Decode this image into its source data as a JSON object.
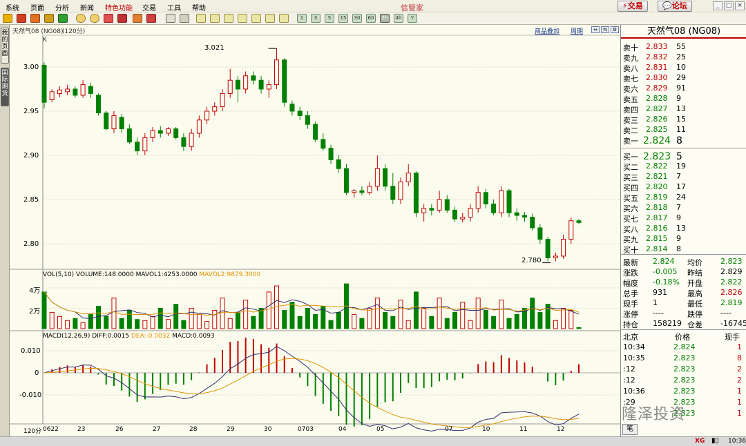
{
  "menu": [
    "系统",
    "页面",
    "分析",
    "新闻",
    "特色功能",
    "交易",
    "工具",
    "帮助"
  ],
  "app_title": "信管家",
  "header_buttons": {
    "trade": "交易",
    "forum": "论坛"
  },
  "toolbar_period_labels": [
    "1",
    "3",
    "5",
    "15",
    "30",
    "60",
    "2h",
    "4h",
    "Y"
  ],
  "left_tabs": [
    "我的页面",
    "国际期货"
  ],
  "chart_header": {
    "title": "天然气08 (NG08)",
    "period": "(120分)",
    "overlay_link": "商品叠加",
    "cycle_link": "周期",
    "type_label": "K",
    "period_label": "120分"
  },
  "kline": {
    "y_ticks": [
      "3.00",
      "2.95",
      "2.90",
      "2.85",
      "2.80"
    ],
    "high_mark": "3.021",
    "low_mark": "2.780"
  },
  "volume_panel": {
    "legend_prefix": "VOL(5,10)",
    "volume": "VOLUME:148.0000",
    "mavol1": "MAVOL1:4253.0000",
    "mavol2": "MAVOL2:9879.3000",
    "y_ticks": [
      "4万",
      "2万"
    ]
  },
  "macd_panel": {
    "legend_prefix": "MACD(12,26,9)",
    "diff": "DIFF:0.0015",
    "dea": "DEA:-0.0032",
    "macd": "MACD:0.0093",
    "y_ticks": [
      "0.010",
      "0",
      "-0.010"
    ]
  },
  "x_axis": [
    "0622",
    "23",
    "26",
    "27",
    "28",
    "29",
    "30",
    "0703",
    "04",
    "05",
    "07",
    "10",
    "11",
    "12"
  ],
  "quote": {
    "title": "天然气08 (NG08)",
    "asks": [
      {
        "label": "卖十",
        "price": "2.833",
        "vol": "55"
      },
      {
        "label": "卖九",
        "price": "2.832",
        "vol": "25"
      },
      {
        "label": "卖八",
        "price": "2.831",
        "vol": "10"
      },
      {
        "label": "卖七",
        "price": "2.830",
        "vol": "29"
      },
      {
        "label": "卖六",
        "price": "2.829",
        "vol": "91"
      },
      {
        "label": "卖五",
        "price": "2.828",
        "vol": "9"
      },
      {
        "label": "卖四",
        "price": "2.827",
        "vol": "13"
      },
      {
        "label": "卖三",
        "price": "2.826",
        "vol": "15"
      },
      {
        "label": "卖二",
        "price": "2.825",
        "vol": "11"
      },
      {
        "label": "卖一",
        "price": "2.824",
        "vol": "8"
      }
    ],
    "bids": [
      {
        "label": "买一",
        "price": "2.823",
        "vol": "5"
      },
      {
        "label": "买二",
        "price": "2.822",
        "vol": "19"
      },
      {
        "label": "买三",
        "price": "2.821",
        "vol": "7"
      },
      {
        "label": "买四",
        "price": "2.820",
        "vol": "17"
      },
      {
        "label": "买五",
        "price": "2.819",
        "vol": "24"
      },
      {
        "label": "买六",
        "price": "2.818",
        "vol": "7"
      },
      {
        "label": "买七",
        "price": "2.817",
        "vol": "9"
      },
      {
        "label": "买八",
        "price": "2.816",
        "vol": "13"
      },
      {
        "label": "买九",
        "price": "2.815",
        "vol": "9"
      },
      {
        "label": "买十",
        "price": "2.814",
        "vol": "8"
      }
    ],
    "stats": [
      {
        "l1": "最新",
        "v1": "2.824",
        "l2": "均价",
        "v2": "2.823"
      },
      {
        "l1": "涨跌",
        "v1": "-0.005",
        "l2": "昨结",
        "v2": "2.829"
      },
      {
        "l1": "幅度",
        "v1": "-0.18%",
        "l2": "开盘",
        "v2": "2.822"
      },
      {
        "l1": "总手",
        "v1": "931",
        "l2": "最高",
        "v2": "2.826"
      },
      {
        "l1": "现手",
        "v1": "1",
        "l2": "最低",
        "v2": "2.819"
      },
      {
        "l1": "涨停",
        "v1": "----",
        "l2": "跌停",
        "v2": "----"
      },
      {
        "l1": "持仓",
        "v1": "158219",
        "l2": "仓差",
        "v2": "-16745"
      }
    ],
    "ticks_header": {
      "c1": "北京",
      "c2": "价格",
      "c3": "现手"
    },
    "ticks": [
      {
        "t": "10:34",
        "p": "2.824",
        "v": "1"
      },
      {
        "t": "10:35",
        "p": "2.823",
        "v": "8"
      },
      {
        "t": ":12",
        "p": "2.823",
        "v": "2"
      },
      {
        "t": ":12",
        "p": "2.823",
        "v": "2"
      },
      {
        "t": "10:36",
        "p": "2.823",
        "v": "1"
      },
      {
        "t": ":29",
        "p": "2.823",
        "v": "1"
      },
      {
        "t": "",
        "p": "2.823",
        "v": "1"
      }
    ],
    "bottom_tab": "笔"
  },
  "status": {
    "time": "10:36",
    "brand": "XG"
  },
  "watermark": "隆泽投资",
  "colors": {
    "up": "#c00000",
    "down": "#008000",
    "bg": "#fcfcee"
  },
  "chart_data": {
    "type": "candlestick",
    "candles": [
      [
        3.002,
        3.005,
        2.953,
        2.96
      ],
      [
        2.963,
        2.975,
        2.96,
        2.972
      ],
      [
        2.97,
        2.978,
        2.966,
        2.974
      ],
      [
        2.972,
        2.98,
        2.968,
        2.975
      ],
      [
        2.975,
        2.978,
        2.965,
        2.968
      ],
      [
        2.968,
        2.985,
        2.965,
        2.98
      ],
      [
        2.978,
        2.982,
        2.965,
        2.97
      ],
      [
        2.968,
        2.97,
        2.945,
        2.948
      ],
      [
        2.948,
        2.95,
        2.928,
        2.93
      ],
      [
        2.93,
        2.95,
        2.925,
        2.945
      ],
      [
        2.943,
        2.947,
        2.925,
        2.93
      ],
      [
        2.93,
        2.935,
        2.913,
        2.915
      ],
      [
        2.915,
        2.92,
        2.9,
        2.905
      ],
      [
        2.905,
        2.925,
        2.9,
        2.92
      ],
      [
        2.92,
        2.932,
        2.915,
        2.928
      ],
      [
        2.928,
        2.933,
        2.92,
        2.925
      ],
      [
        2.925,
        2.932,
        2.922,
        2.93
      ],
      [
        2.93,
        2.932,
        2.918,
        2.92
      ],
      [
        2.92,
        2.925,
        2.905,
        2.91
      ],
      [
        2.91,
        2.93,
        2.905,
        2.925
      ],
      [
        2.925,
        2.945,
        2.92,
        2.94
      ],
      [
        2.94,
        2.955,
        2.935,
        2.95
      ],
      [
        2.95,
        2.96,
        2.945,
        2.955
      ],
      [
        2.955,
        2.975,
        2.95,
        2.97
      ],
      [
        2.97,
        2.998,
        2.965,
        2.985
      ],
      [
        2.985,
        2.99,
        2.96,
        2.975
      ],
      [
        2.975,
        2.995,
        2.97,
        2.99
      ],
      [
        2.99,
        2.995,
        2.98,
        2.985
      ],
      [
        2.985,
        2.99,
        2.97,
        2.975
      ],
      [
        2.975,
        2.985,
        2.965,
        2.98
      ],
      [
        2.98,
        3.021,
        2.975,
        3.008
      ],
      [
        3.008,
        3.01,
        2.955,
        2.96
      ],
      [
        2.958,
        2.962,
        2.945,
        2.95
      ],
      [
        2.95,
        2.955,
        2.94,
        2.945
      ],
      [
        2.945,
        2.95,
        2.93,
        2.935
      ],
      [
        2.935,
        2.938,
        2.915,
        2.918
      ],
      [
        2.918,
        2.925,
        2.905,
        2.908
      ],
      [
        2.908,
        2.912,
        2.89,
        2.895
      ],
      [
        2.895,
        2.9,
        2.88,
        2.885
      ],
      [
        2.885,
        2.89,
        2.855,
        2.858
      ],
      [
        2.858,
        2.862,
        2.852,
        2.86
      ],
      [
        2.86,
        2.865,
        2.855,
        2.858
      ],
      [
        2.858,
        2.87,
        2.855,
        2.865
      ],
      [
        2.865,
        2.9,
        2.86,
        2.885
      ],
      [
        2.885,
        2.89,
        2.86,
        2.865
      ],
      [
        2.865,
        2.88,
        2.845,
        2.85
      ],
      [
        2.85,
        2.875,
        2.845,
        2.87
      ],
      [
        2.87,
        2.89,
        2.865,
        2.88
      ],
      [
        2.88,
        2.882,
        2.83,
        2.835
      ],
      [
        2.835,
        2.845,
        2.825,
        2.84
      ],
      [
        2.84,
        2.845,
        2.832,
        2.838
      ],
      [
        2.838,
        2.86,
        2.835,
        2.85
      ],
      [
        2.85,
        2.855,
        2.835,
        2.838
      ],
      [
        2.838,
        2.842,
        2.825,
        2.828
      ],
      [
        2.828,
        2.835,
        2.824,
        2.83
      ],
      [
        2.83,
        2.845,
        2.825,
        2.84
      ],
      [
        2.84,
        2.865,
        2.835,
        2.858
      ],
      [
        2.858,
        2.862,
        2.84,
        2.845
      ],
      [
        2.845,
        2.85,
        2.832,
        2.835
      ],
      [
        2.835,
        2.865,
        2.83,
        2.86
      ],
      [
        2.86,
        2.862,
        2.83,
        2.835
      ],
      [
        2.835,
        2.84,
        2.826,
        2.832
      ],
      [
        2.832,
        2.836,
        2.825,
        2.83
      ],
      [
        2.83,
        2.834,
        2.815,
        2.818
      ],
      [
        2.818,
        2.822,
        2.8,
        2.805
      ],
      [
        2.805,
        2.808,
        2.78,
        2.784
      ],
      [
        2.784,
        2.79,
        2.78,
        2.786
      ],
      [
        2.786,
        2.81,
        2.783,
        2.805
      ],
      [
        2.805,
        2.83,
        2.8,
        2.826
      ],
      [
        2.826,
        2.828,
        2.822,
        2.824
      ]
    ],
    "volume": [
      36000,
      16000,
      12000,
      8000,
      10000,
      6000,
      14000,
      22000,
      12000,
      30000,
      10000,
      18000,
      9000,
      8000,
      12000,
      20000,
      9000,
      24000,
      8000,
      20000,
      14000,
      7000,
      18000,
      30000,
      10000,
      16000,
      28000,
      12000,
      20000,
      36000,
      42000,
      18000,
      26000,
      12000,
      20000,
      14000,
      22000,
      8000,
      16000,
      44000,
      14000,
      10000,
      20000,
      30000,
      16000,
      12000,
      28000,
      8000,
      36000,
      20000,
      12000,
      30000,
      10000,
      16000,
      26000,
      8000,
      30000,
      18000,
      12000,
      28000,
      10000,
      14000,
      20000,
      30000,
      16000,
      24000,
      8000,
      20000,
      18000,
      1000
    ],
    "macd": {
      "x_range": [
        0,
        69
      ],
      "y_ticks": [
        0.01,
        0,
        -0.01
      ]
    }
  }
}
